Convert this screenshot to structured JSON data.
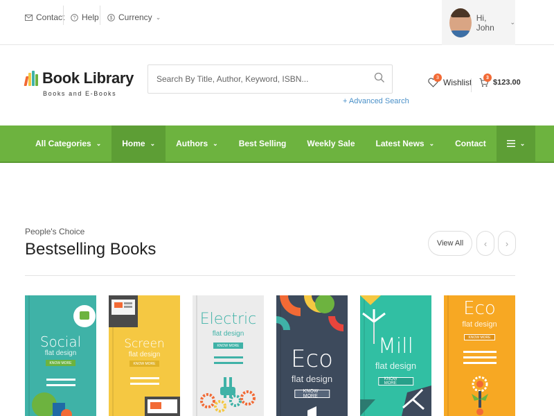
{
  "topbar": {
    "contact": "Contact",
    "help": "Help",
    "currency": "Currency",
    "user_greeting": "Hi, John"
  },
  "header": {
    "logo_title": "Book Library",
    "logo_subtitle": "Books and E-Books",
    "search_placeholder": "Search By Title, Author, Keyword, ISBN...",
    "advanced_search": "+ Advanced Search",
    "wishlist_label": "Wishlist",
    "wishlist_count": "3",
    "cart_count": "3",
    "cart_total": "$123.00"
  },
  "nav": {
    "items": [
      {
        "label": "All Categories"
      },
      {
        "label": "Home"
      },
      {
        "label": "Authors"
      },
      {
        "label": "Best Selling"
      },
      {
        "label": "Weekly Sale"
      },
      {
        "label": "Latest News"
      },
      {
        "label": "Contact"
      }
    ]
  },
  "section": {
    "eyebrow": "People's Choice",
    "title": "Bestselling Books",
    "view_all": "View All"
  },
  "books": [
    {
      "title": "Social",
      "subtitle": "flat design",
      "button": "KNOW MORE",
      "color": "#3fb2a7"
    },
    {
      "title": "Screen",
      "subtitle": "flat design",
      "button": "KNOW MORE",
      "color": "#f5c842"
    },
    {
      "title": "Electric",
      "subtitle": "flat design",
      "button": "KNOW MORE",
      "color": "#ececec"
    },
    {
      "title": "Eco",
      "subtitle": "flat design",
      "button": "KNOW MORE",
      "color": "#3d4a5c"
    },
    {
      "title": "Mill",
      "subtitle": "flat design",
      "button": "KNOW MORE",
      "color": "#31bfa3"
    },
    {
      "title": "Eco",
      "subtitle": "flat design",
      "button": "KNOW MORE",
      "color": "#f7a823"
    }
  ],
  "colors": {
    "nav_green": "#6db33f",
    "nav_active": "#5d9e35",
    "badge_orange": "#f26a35",
    "link_blue": "#4a90c8"
  },
  "icons": [
    "envelope-icon",
    "help-icon",
    "currency-icon",
    "search-icon",
    "heart-icon",
    "cart-icon",
    "hamburger-icon",
    "chevron-left-icon",
    "chevron-right-icon"
  ]
}
